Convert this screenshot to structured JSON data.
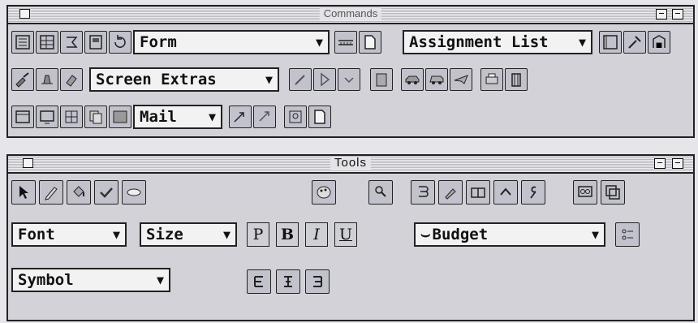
{
  "commands": {
    "title": "Commands",
    "form_dropdown": "Form",
    "assignment_dropdown": "Assignment List",
    "screen_extras_dropdown": "Screen Extras",
    "mail_dropdown": "Mail",
    "arrow": "▼"
  },
  "tools": {
    "title": "Tools",
    "font_dropdown": "Font",
    "size_dropdown": "Size",
    "budget_dropdown": "Budget",
    "symbol_dropdown": "Symbol",
    "plain": "P",
    "bold": "B",
    "italic": "I",
    "underline": "U",
    "arrow": "▼",
    "budget_glyph": "⌣"
  },
  "colors": {
    "panel": "#d2d2d8",
    "button": "#c2c2cc",
    "frame": "#222222"
  }
}
